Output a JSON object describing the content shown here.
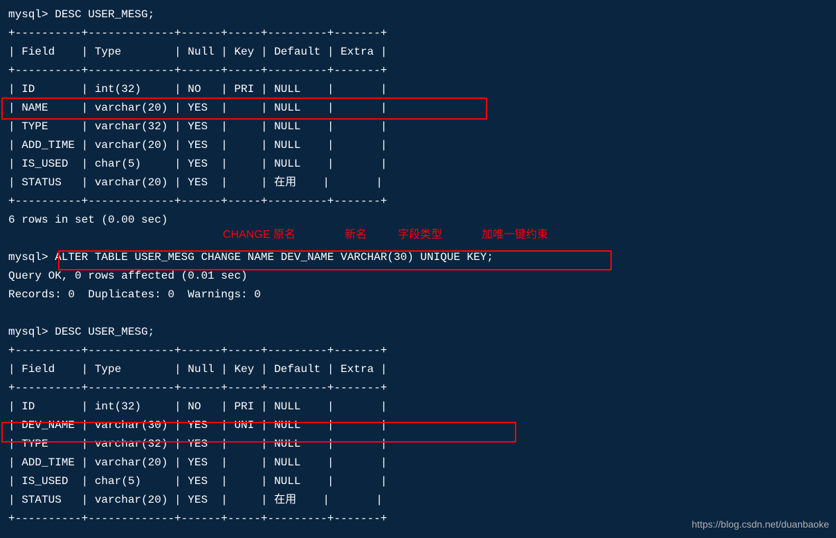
{
  "lines": {
    "l1": "mysql> DESC USER_MESG;",
    "l2": "+----------+-------------+------+-----+---------+-------+",
    "l3": "| Field    | Type        | Null | Key | Default | Extra |",
    "l4": "+----------+-------------+------+-----+---------+-------+",
    "l5": "| ID       | int(32)     | NO   | PRI | NULL    |       |",
    "l6": "| NAME     | varchar(20) | YES  |     | NULL    |       |",
    "l7": "| TYPE     | varchar(32) | YES  |     | NULL    |       |",
    "l8": "| ADD_TIME | varchar(20) | YES  |     | NULL    |       |",
    "l9": "| IS_USED  | char(5)     | YES  |     | NULL    |       |",
    "l10": "| STATUS   | varchar(20) | YES  |     | 在用    |       |",
    "l11": "+----------+-------------+------+-----+---------+-------+",
    "l12": "6 rows in set (0.00 sec)",
    "blank1": " ",
    "l13a": "mysql> ",
    "l13b": "ALTER TABLE USER_MESG CHANGE NAME DEV_NAME VARCHAR(30) UNIQUE KEY;",
    "l14": "Query OK, 0 rows affected (0.01 sec)",
    "l15": "Records: 0  Duplicates: 0  Warnings: 0",
    "blank2": " ",
    "l17": "mysql> DESC USER_MESG;",
    "l18": "+----------+-------------+------+-----+---------+-------+",
    "l19": "| Field    | Type        | Null | Key | Default | Extra |",
    "l20": "+----------+-------------+------+-----+---------+-------+",
    "l21": "| ID       | int(32)     | NO   | PRI | NULL    |       |",
    "l22": "| DEV_NAME | varchar(30) | YES  | UNI | NULL    |       |",
    "l23": "| TYPE     | varchar(32) | YES  |     | NULL    |       |",
    "l24": "| ADD_TIME | varchar(20) | YES  |     | NULL    |       |",
    "l25": "| IS_USED  | char(5)     | YES  |     | NULL    |       |",
    "l26": "| STATUS   | varchar(20) | YES  |     | 在用    |       |",
    "l27": "+----------+-------------+------+-----+---------+-------+"
  },
  "annotations": {
    "a1": "CHANGE 原名",
    "a2": "新名",
    "a3": "字段类型",
    "a4": "加唯一键约束"
  },
  "watermark": "https://blog.csdn.net/duanbaoke"
}
